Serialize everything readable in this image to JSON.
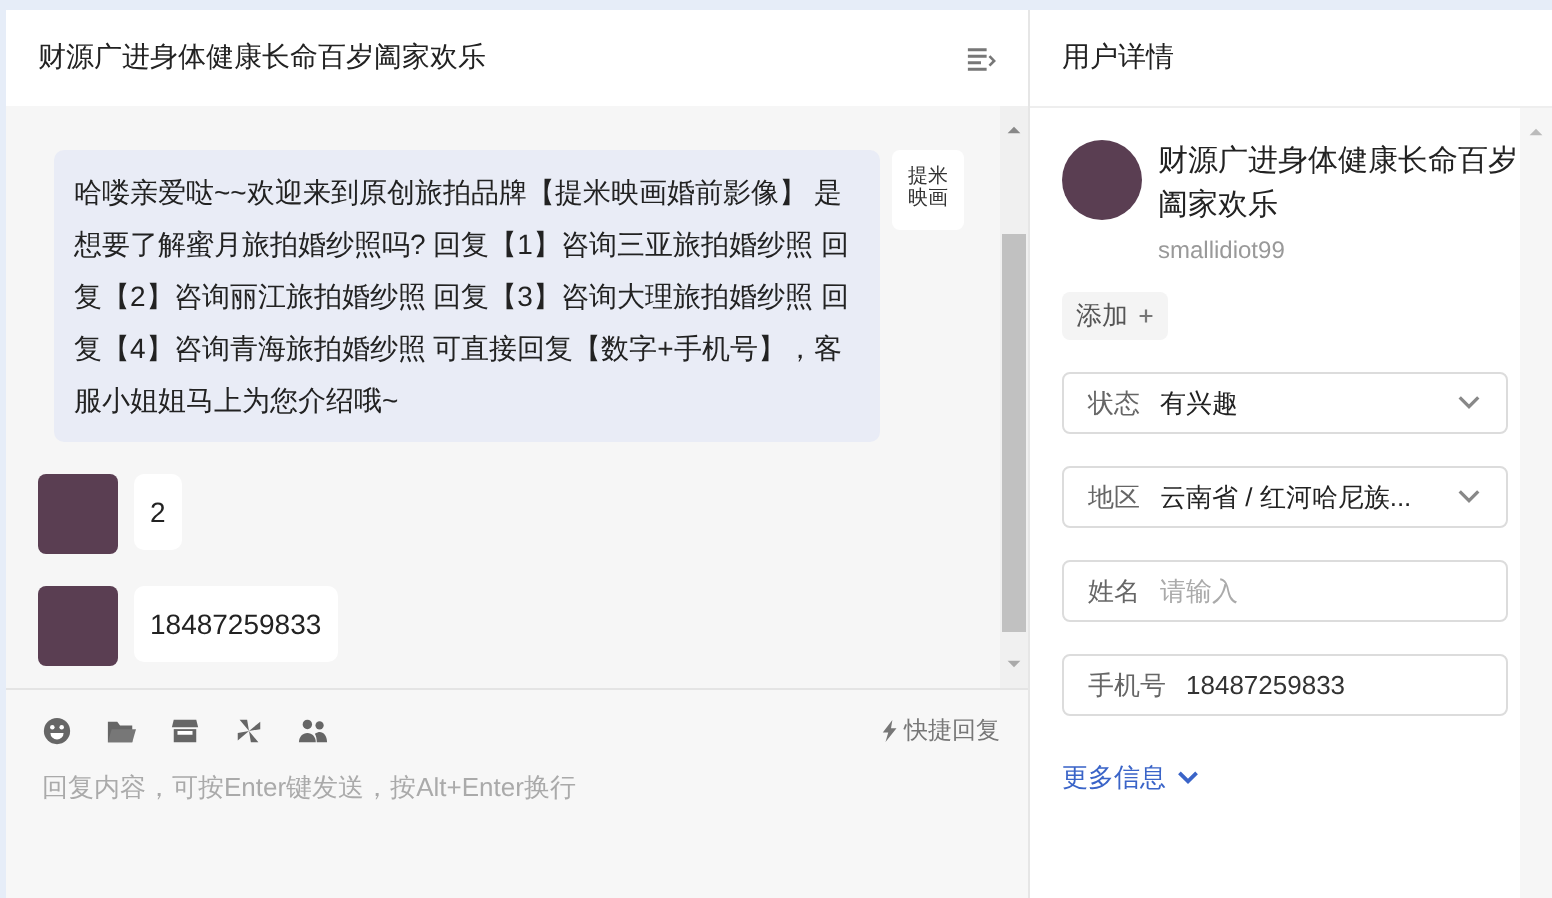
{
  "chat": {
    "title": "财源广进身体健康长命百岁阖家欢乐",
    "messages": [
      {
        "kind": "outgoing",
        "text": "哈喽亲爱哒~~欢迎来到原创旅拍品牌【提米映画婚前影像】 是想要了解蜜月旅拍婚纱照吗? 回复【1】咨询三亚旅拍婚纱照 回复【2】咨询丽江旅拍婚纱照 回复【3】咨询大理旅拍婚纱照 回复【4】咨询青海旅拍婚纱照 可直接回复【数字+手机号】，客服小姐姐马上为您介绍哦~",
        "logo": "提米映画"
      },
      {
        "kind": "incoming",
        "text": "2"
      },
      {
        "kind": "incoming",
        "text": "18487259833"
      }
    ],
    "toolbar": {
      "quick_reply": "快捷回复"
    },
    "composer": {
      "placeholder": "回复内容，可按Enter键发送，按Alt+Enter换行"
    }
  },
  "details": {
    "title": "用户详情",
    "name": "财源广进身体健康长命百岁阖家欢乐",
    "username": "smallidiot99",
    "add_button": "添加",
    "fields": [
      {
        "kind": "select",
        "label": "状态",
        "value": "有兴趣"
      },
      {
        "kind": "select",
        "label": "地区",
        "value": "云南省 / 红河哈尼族..."
      },
      {
        "kind": "input",
        "label": "姓名",
        "placeholder": "请输入"
      },
      {
        "kind": "input",
        "label": "手机号",
        "value": "18487259833"
      }
    ],
    "more_link": "更多信息"
  }
}
